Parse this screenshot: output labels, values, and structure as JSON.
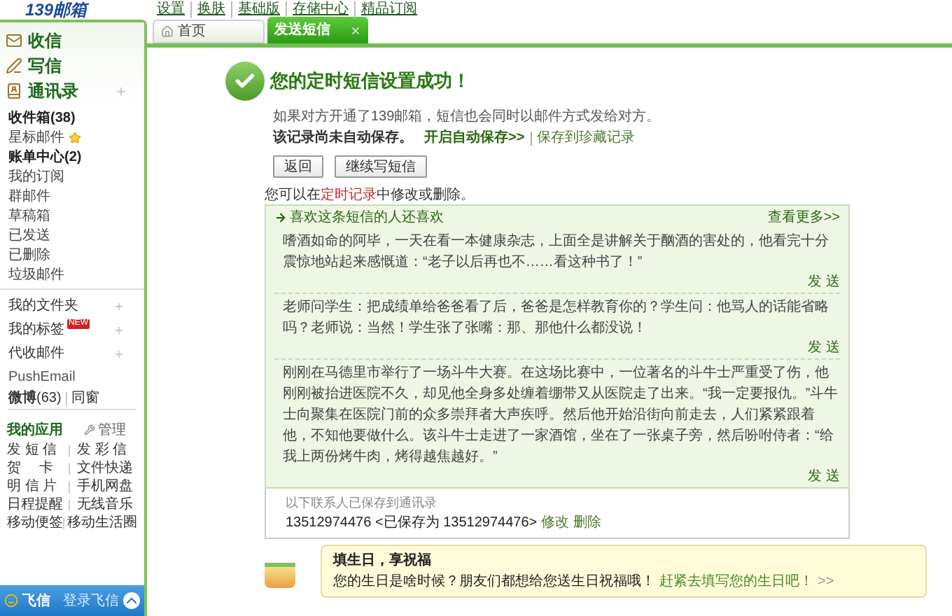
{
  "header": {
    "logo": "139邮箱",
    "links": [
      "设置",
      "换肤",
      "基础版",
      "存储中心",
      "精品订阅"
    ]
  },
  "sidebar": {
    "actions": [
      {
        "kind": "inbox",
        "label": "收信",
        "addable": false
      },
      {
        "kind": "compose",
        "label": "写信",
        "addable": false
      },
      {
        "kind": "contacts",
        "label": "通讯录",
        "addable": true
      }
    ],
    "folders": [
      {
        "label": "收件箱(38)",
        "unread": true,
        "starred": false
      },
      {
        "label": "星标邮件",
        "unread": false,
        "starred": true
      },
      {
        "label": "账单中心(2)",
        "unread": true,
        "starred": false
      },
      {
        "label": "我的订阅",
        "unread": false,
        "starred": false
      },
      {
        "label": "群邮件",
        "unread": false,
        "starred": false
      },
      {
        "label": "草稿箱",
        "unread": false,
        "starred": false
      },
      {
        "label": "已发送",
        "unread": false,
        "starred": false
      },
      {
        "label": "已删除",
        "unread": false,
        "starred": false
      },
      {
        "label": "垃圾邮件",
        "unread": false,
        "starred": false
      }
    ],
    "groups": [
      {
        "label": "我的文件夹"
      },
      {
        "label": "我的标签",
        "badge": "NEW"
      },
      {
        "label": "代收邮件"
      }
    ],
    "push": "PushEmail",
    "weibo": "微博",
    "weibo_count": "(63)",
    "classmates": "同窗",
    "apps": {
      "title": "我的应用",
      "manage": "管理",
      "items": [
        [
          "发 短 信",
          "发 彩 信"
        ],
        [
          "贺　 卡",
          "文件快递"
        ],
        [
          "明 信 片",
          "手机网盘"
        ],
        [
          "日程提醒",
          "无线音乐"
        ],
        [
          "移动便签",
          "移动生活圈"
        ]
      ]
    },
    "fetion": {
      "name": "飞信",
      "login": "登录飞信"
    }
  },
  "tabs": [
    {
      "label": "首页",
      "selected": false,
      "closable": false
    },
    {
      "label": "发送短信",
      "selected": true,
      "closable": true
    }
  ],
  "main": {
    "title": "您的定时短信设置成功！",
    "note": "如果对方开通了139邮箱，短信也会同时以邮件方式发给对方。",
    "autosave": {
      "text": "该记录尚未自动保存。",
      "link": "开启自动保存>>",
      "link2": "保存到珍藏记录"
    },
    "buttons": [
      "返回",
      "继续写短信"
    ],
    "edit_note": {
      "before": "您可以在",
      "link": "定时记录",
      "after": "中修改或删除。"
    },
    "recommend": {
      "title": "喜欢这条短信的人还喜欢",
      "more": "查看更多>>",
      "items": [
        {
          "text": "嗜酒如命的阿毕，一天在看一本健康杂志，上面全是讲解关于酗酒的害处的，他看完十分震惊地站起来感慨道：“老子以后再也不……看这种书了！”",
          "send": "发 送"
        },
        {
          "text": "老师问学生：把成绩单给爸爸看了后，爸爸是怎样教育你的？学生问：他骂人的话能省略吗？老师说：当然！学生张了张嘴：那、那他什么都没说！",
          "send": "发 送"
        },
        {
          "text": "刚刚在马德里市举行了一场斗牛大赛。在这场比赛中，一位著名的斗牛士严重受了伤，他刚刚被抬进医院不久，却见他全身多处缠着绷带又从医院走了出来。“我一定要报仇。”斗牛士向聚集在医院门前的众多崇拜者大声疾呼。然后他开始沿街向前走去，人们紧紧跟着他，不知他要做什么。该斗牛士走进了一家酒馆，坐在了一张桌子旁，然后吩咐侍者：“给我上两份烤牛肉，烤得越焦越好。”",
          "send": "发 送"
        }
      ]
    },
    "contacts": {
      "title": "以下联系人已保存到通讯录",
      "entry": "13512974476 <已保存为 13512974476>",
      "edit": "修改",
      "delete": "删除"
    },
    "birthday": {
      "title": "填生日，享祝福",
      "text": "您的生日是啥时候？朋友们都想给您送生日祝福哦！",
      "link": "赶紧去填写您的生日吧！",
      "more": ">>"
    }
  }
}
